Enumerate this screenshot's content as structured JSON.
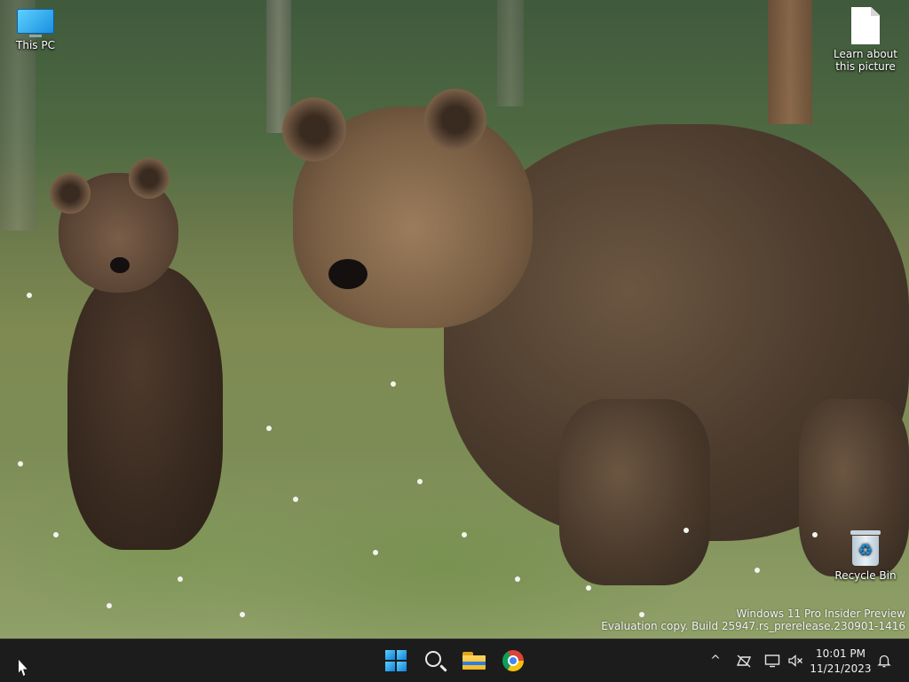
{
  "desktop": {
    "icons": [
      {
        "label": "This PC",
        "icon": "monitor-icon"
      },
      {
        "label": "Learn about this picture",
        "icon": "document-icon"
      },
      {
        "label": "Recycle Bin",
        "icon": "recycle-bin-icon"
      }
    ],
    "watermark": {
      "line1": "Windows 11 Pro Insider Preview",
      "line2": "Evaluation copy. Build 25947.rs_prerelease.230901-1416"
    },
    "wallpaper": "brown-bear-and-cub-in-meadow"
  },
  "taskbar": {
    "apps": [
      {
        "name": "Start",
        "icon": "windows-logo-icon"
      },
      {
        "name": "Search",
        "icon": "search-icon"
      },
      {
        "name": "File Explorer",
        "icon": "folder-icon"
      },
      {
        "name": "Google Chrome",
        "icon": "chrome-icon"
      }
    ],
    "tray": {
      "chevron": "^",
      "network_icon": "network-disconnected-icon",
      "display_icon": "display-icon",
      "sound_icon": "sound-muted-icon",
      "bell_icon": "notification-bell-icon"
    },
    "clock": {
      "time": "10:01 PM",
      "date": "11/21/2023"
    },
    "colors": {
      "background": "#1c1c1c",
      "accent": "#0f7fd8"
    }
  }
}
